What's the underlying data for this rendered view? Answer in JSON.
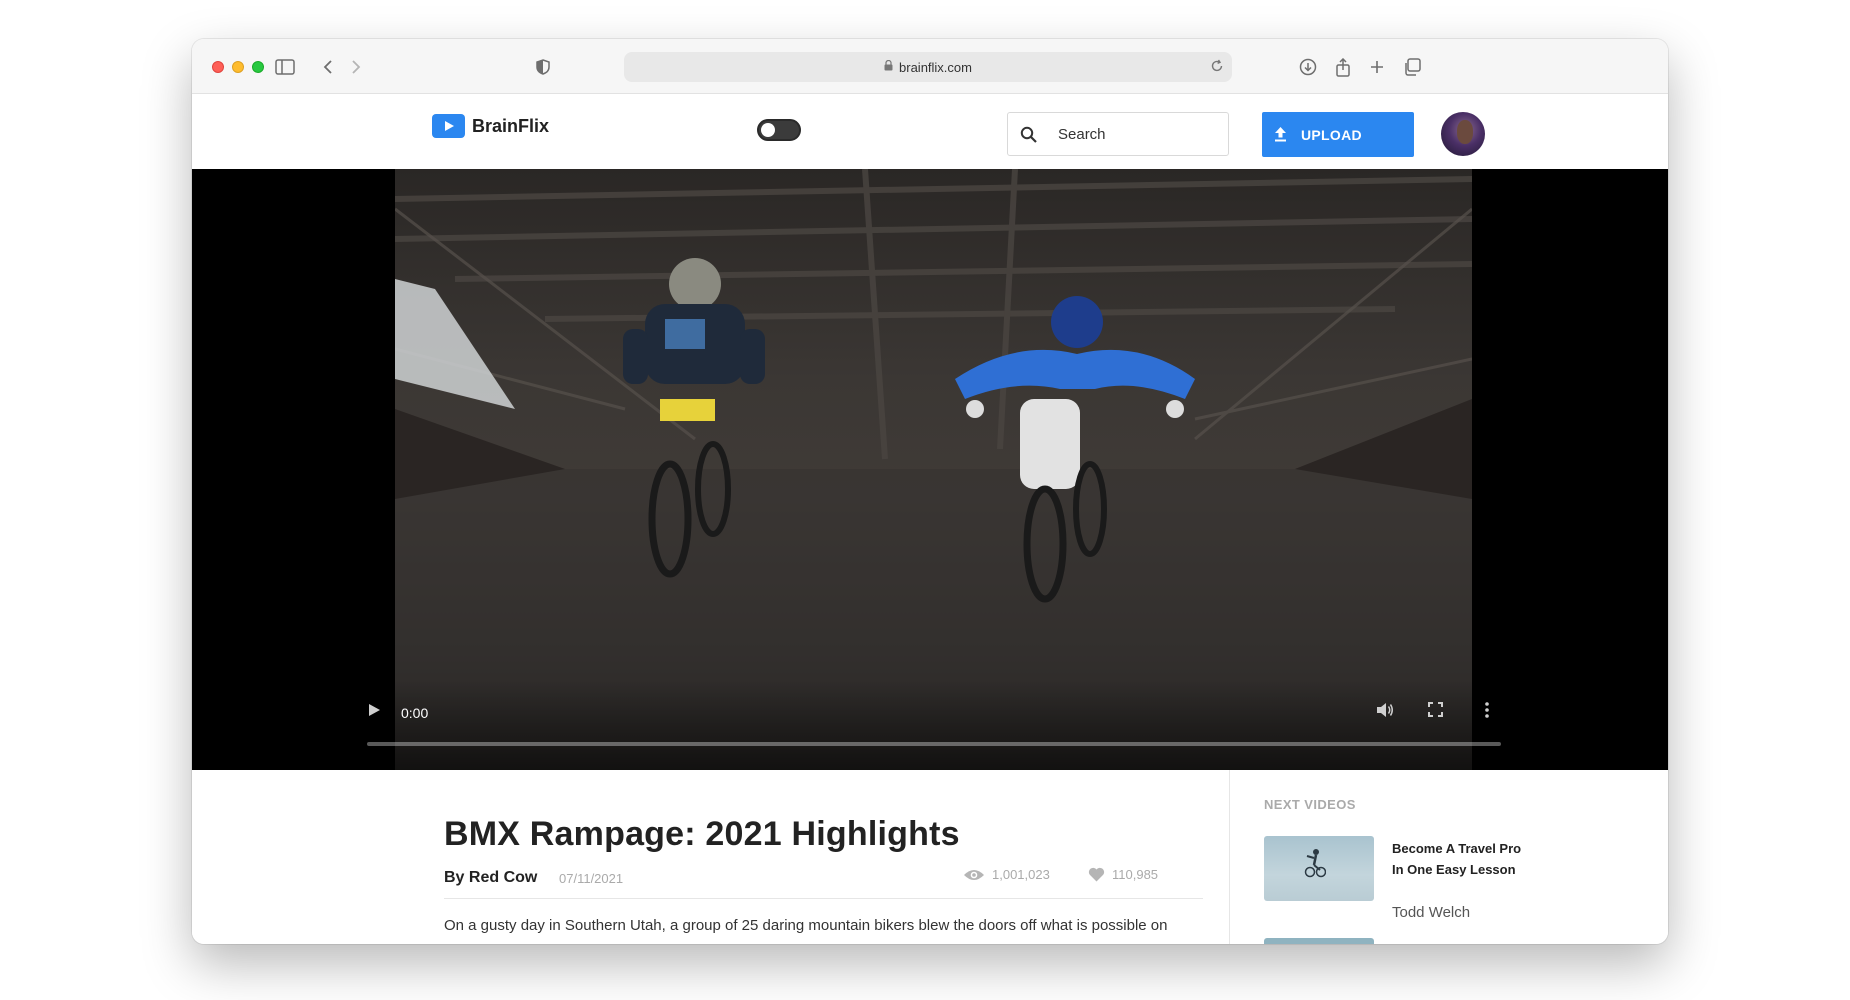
{
  "browser": {
    "url": "brainflix.com"
  },
  "header": {
    "brand": "BrainFlix",
    "search_placeholder": "Search",
    "upload_label": "UPLOAD",
    "accent_color": "#2b87f0"
  },
  "video": {
    "current_time": "0:00",
    "progress": 0
  },
  "details": {
    "title": "BMX Rampage: 2021 Highlights",
    "byline": "By Red Cow",
    "date": "07/11/2021",
    "views": "1,001,023",
    "likes": "110,985",
    "description": "On a gusty day in Southern Utah, a group of 25 daring mountain bikers blew the doors off what is possible on"
  },
  "sidebar": {
    "heading": "NEXT VIDEOS",
    "videos": [
      {
        "title": "Become A Travel Pro In One Easy Lesson",
        "author": "Todd Welch"
      }
    ]
  }
}
